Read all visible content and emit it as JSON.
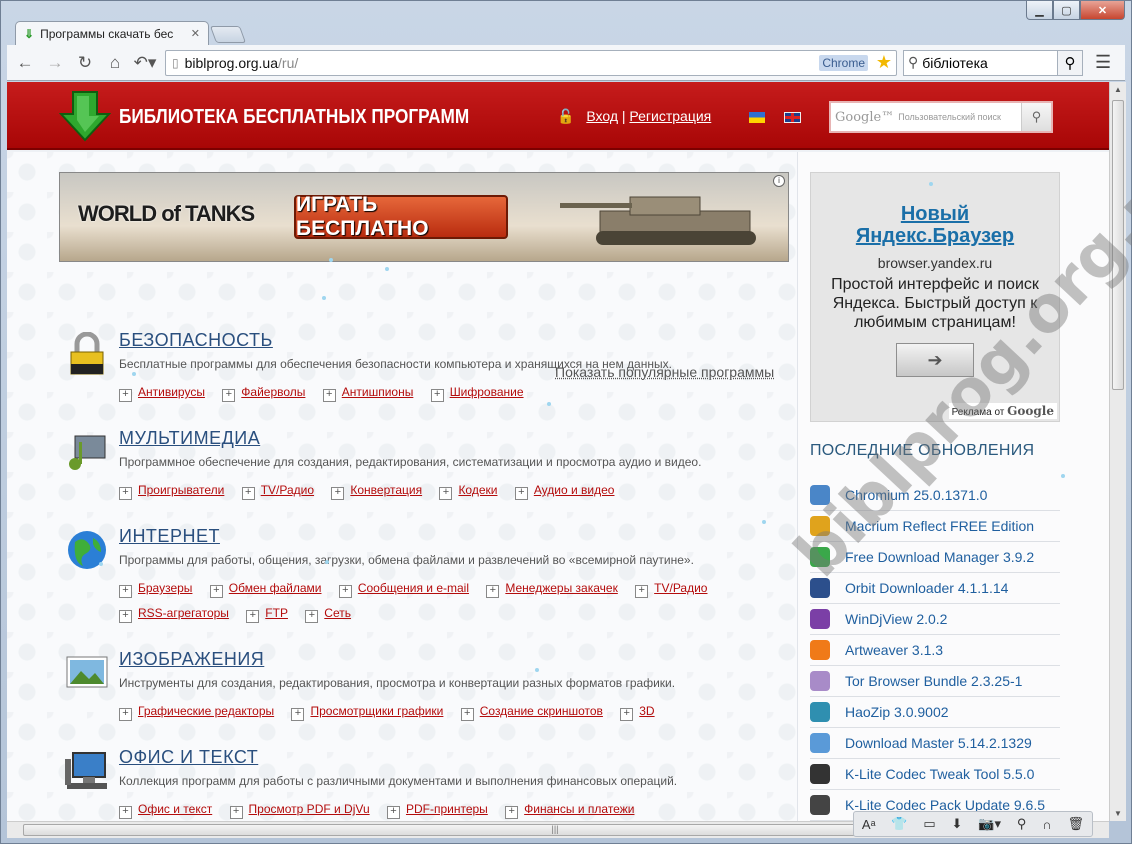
{
  "browser": {
    "tab_title": "Программы скачать бес",
    "address_host": "biblprog.org.ua",
    "address_path": "/ru/",
    "chrome_label": "Chrome",
    "search_value": "бібліотека"
  },
  "header": {
    "site_title": "БИБЛИОТЕКА БЕСПЛАТНЫХ ПРОГРАММ",
    "login": "Вход",
    "separator": "|",
    "register": "Регистрация",
    "search_logo": "Google™",
    "search_placeholder": "Пользовательский поиск"
  },
  "banner": {
    "brand": "WORLD of TANKS",
    "cta": "ИГРАТЬ БЕСПЛАТНО"
  },
  "popular_link": "Показать популярные программы",
  "categories": [
    {
      "title": "БЕЗОПАСНОСТЬ",
      "desc": "Бесплатные программы для обеспечения безопасности компьютера и хранящихся на нем данных.",
      "links": [
        "Антивирусы",
        "Файерволы",
        "Антишпионы",
        "Шифрование"
      ]
    },
    {
      "title": "МУЛЬТИМЕДИА",
      "desc": "Программное обеспечение для создания, редактирования, систематизации и просмотра аудио и видео.",
      "links": [
        "Проигрыватели",
        "TV/Радио",
        "Конвертация",
        "Кодеки",
        "Аудио и видео"
      ]
    },
    {
      "title": "ИНТЕРНЕТ",
      "desc": "Программы для работы, общения, загрузки, обмена файлами и развлечений во «всемирной паутине».",
      "links": [
        "Браузеры",
        "Обмен файлами",
        "Сообщения и e-mail",
        "Менеджеры закачек",
        "TV/Радио",
        "RSS-агрегаторы",
        "FTP",
        "Сеть"
      ]
    },
    {
      "title": "ИЗОБРАЖЕНИЯ",
      "desc": "Инструменты для создания, редактирования, просмотра и конвертации разных форматов графики.",
      "links": [
        "Графические редакторы",
        "Просмотрщики графики",
        "Создание скриншотов",
        "3D"
      ]
    },
    {
      "title": "ОФИС И ТЕКСТ",
      "desc": "Коллекция программ для работы с различными документами и выполнения финансовых операций.",
      "links": [
        "Офис и текст",
        "Просмотр PDF и DjVu",
        "PDF-принтеры",
        "Финансы и платежи"
      ]
    }
  ],
  "yandex_ad": {
    "title": "Новый Яндекс.Браузер",
    "url": "browser.yandex.ru",
    "text": "Простой интерфейс и поиск Яндекса. Быстрый доступ к любимым страницам!",
    "note_prefix": "Реклама от",
    "note_brand": "Google"
  },
  "updates": {
    "title": "ПОСЛЕДНИЕ ОБНОВЛЕНИЯ",
    "items": [
      {
        "name": "Chromium 25.0.1371.0",
        "color": "#4a86c8"
      },
      {
        "name": "Macrium Reflect FREE Edition",
        "color": "#e0a31c"
      },
      {
        "name": "Free Download Manager 3.9.2",
        "color": "#3aa84a"
      },
      {
        "name": "Orbit Downloader 4.1.1.14",
        "color": "#2c4f8c"
      },
      {
        "name": "WinDjView 2.0.2",
        "color": "#7b3fa6"
      },
      {
        "name": "Artweaver 3.1.3",
        "color": "#f07a18"
      },
      {
        "name": "Tor Browser Bundle 2.3.25-1",
        "color": "#a88bc8"
      },
      {
        "name": "HaoZip 3.0.9002",
        "color": "#2f8fb0"
      },
      {
        "name": "Download Master 5.14.2.1329",
        "color": "#5a9ad8"
      },
      {
        "name": "K-Lite Codec Tweak Tool 5.5.0",
        "color": "#333333"
      },
      {
        "name": "K-Lite Codec Pack Update 9.6.5",
        "color": "#444444"
      }
    ]
  },
  "watermark": "biblprog.org.ua"
}
